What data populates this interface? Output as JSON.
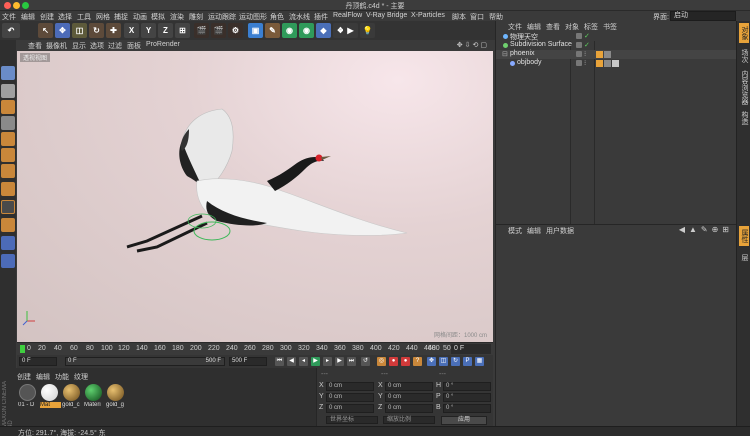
{
  "window": {
    "title": "丹顶鹤.c4d * - 主要"
  },
  "menubar": {
    "items": [
      "文件",
      "编辑",
      "创建",
      "选择",
      "工具",
      "网格",
      "捕捉",
      "动画",
      "模拟",
      "渲染",
      "雕刻",
      "运动跟踪",
      "运动图形",
      "角色",
      "流水线",
      "插件",
      "RealFlow",
      "V-Ray Bridge",
      "X-Particles",
      "脚本",
      "窗口",
      "帮助"
    ],
    "layout_label": "界面:",
    "layout_value": "启动"
  },
  "toolbar": {
    "axis_x": "X",
    "axis_y": "Y",
    "axis_z": "Z"
  },
  "viewport": {
    "menu": [
      "查看",
      "摄像机",
      "显示",
      "选项",
      "过滤",
      "面板",
      "ProRender"
    ],
    "label": "透视视图",
    "scale": "网格间距：1000 cm"
  },
  "timeline": {
    "ticks": [
      "0",
      "20",
      "40",
      "60",
      "80",
      "100",
      "120",
      "140",
      "160",
      "180",
      "200",
      "220",
      "240",
      "260",
      "280",
      "300",
      "320",
      "340",
      "360",
      "380",
      "400",
      "420",
      "440",
      "460",
      "480",
      "500"
    ],
    "end_frame": "0 F"
  },
  "transport": {
    "current": "0 F",
    "start": "0 F",
    "range_end": "500 F",
    "end": "500 F"
  },
  "materials": {
    "menu": [
      "创建",
      "编辑",
      "功能",
      "纹理"
    ],
    "items": [
      {
        "label": "01 - D",
        "color": "#5a5a5a"
      },
      {
        "label": "Mat",
        "color": "#f0f0f0"
      },
      {
        "label": "gold_c",
        "color": "#a0702a"
      },
      {
        "label": "Materi",
        "color": "#1e8a2c"
      },
      {
        "label": "gold_g",
        "color": "#a0702a"
      }
    ],
    "brand": "MAXON CINEMA 4D"
  },
  "coords": {
    "header_left": "---",
    "header_mid": "---",
    "header_right": "---",
    "rows": [
      {
        "axis": "X",
        "pos": "0 cm",
        "size": "0 cm",
        "rot_axis": "H",
        "rot": "0 °"
      },
      {
        "axis": "Y",
        "pos": "0 cm",
        "size": "0 cm",
        "rot_axis": "P",
        "rot": "0 °"
      },
      {
        "axis": "Z",
        "pos": "0 cm",
        "size": "0 cm",
        "rot_axis": "B",
        "rot": "0 °"
      }
    ],
    "mode": "世界坐标",
    "scale_mode": "缩放比例",
    "apply": "应用"
  },
  "status": {
    "text": "方位: 291.7°, 海拔: -24.5° 东"
  },
  "object_manager": {
    "menu": [
      "文件",
      "编辑",
      "查看",
      "对象",
      "标签",
      "书签"
    ],
    "objects": [
      {
        "name": "物理天空",
        "indent": 0,
        "color": "#6fb6ff"
      },
      {
        "name": "Subdivision Surface",
        "indent": 0,
        "color": "#6fd06f"
      },
      {
        "name": "phoenix",
        "indent": 0,
        "color": "#bbbbbb"
      },
      {
        "name": "objbody",
        "indent": 1,
        "color": "#88aaff"
      }
    ]
  },
  "attributes": {
    "menu": [
      "模式",
      "编辑",
      "用户数据"
    ]
  },
  "right_tabs": [
    "对象",
    "场次",
    "内容浏览器",
    "构造",
    "属性",
    "层"
  ]
}
